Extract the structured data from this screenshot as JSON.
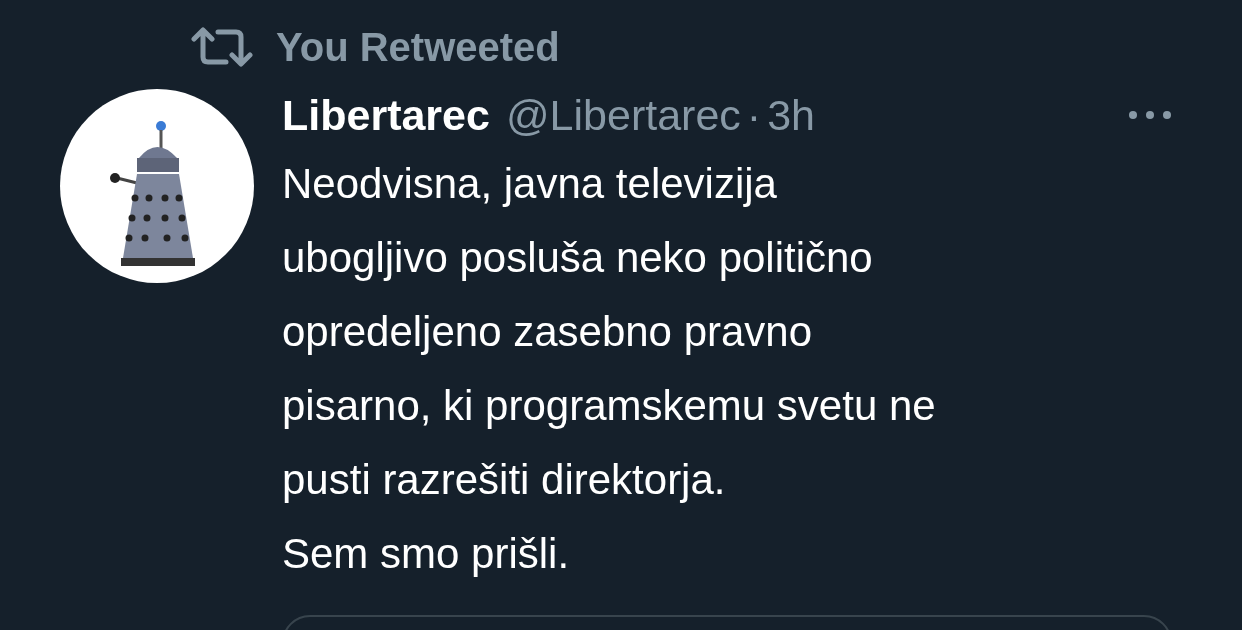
{
  "retweet_label": "You Retweeted",
  "tweet": {
    "name": "Libertarec",
    "handle": "@Libertarec",
    "separator": "·",
    "time": "3h",
    "text": "Neodvisna, javna televizija\nubogljivo posluša neko politično\nopredeljeno zasebno pravno\npisarno, ki programskemu svetu ne\npusti razrešiti direktorja.\nSem smo prišli."
  }
}
